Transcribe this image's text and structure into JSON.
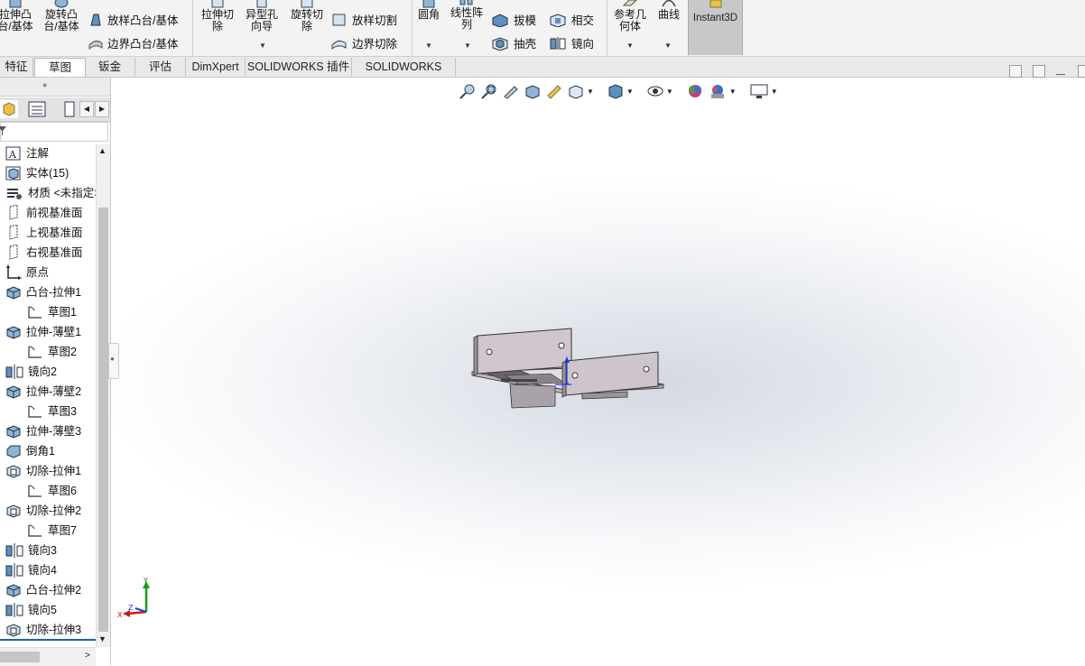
{
  "ribbon": {
    "extrude_boss": "拉伸凸\n台/基体",
    "revolve_boss": "旋转凸\n台/基体",
    "loft_boss": "放样凸台/基体",
    "boundary_boss": "边界凸台/基体",
    "extrude_cut": "拉伸切\n除",
    "hole_wizard": "异型孔\n向导",
    "revolve_cut": "旋转切\n除",
    "loft_cut": "放样切割",
    "boundary_cut": "边界切除",
    "fillet": "圆角",
    "linear_pattern": "线性阵\n列",
    "draft": "拔模",
    "shell": "抽壳",
    "intersect": "相交",
    "mirror": "镜向",
    "ref_geometry": "参考几\n何体",
    "curves": "曲线",
    "instant3d": "Instant3D"
  },
  "tabs": [
    "特征",
    "草图",
    "钣金",
    "评估",
    "DimXpert",
    "SOLIDWORKS 插件",
    "SOLIDWORKS MBD"
  ],
  "tree": [
    {
      "label": "注解",
      "icon": "annotation-icon"
    },
    {
      "label": "实体(15)",
      "icon": "solid-bodies-icon"
    },
    {
      "label": "材质 <未指定>",
      "icon": "material-icon"
    },
    {
      "label": "前视基准面",
      "icon": "plane-icon"
    },
    {
      "label": "上视基准面",
      "icon": "plane-icon"
    },
    {
      "label": "右视基准面",
      "icon": "plane-icon"
    },
    {
      "label": "原点",
      "icon": "origin-icon"
    },
    {
      "label": "凸台-拉伸1",
      "icon": "extrude-icon"
    },
    {
      "label": "草图1",
      "icon": "sketch-icon"
    },
    {
      "label": "拉伸-薄壁1",
      "icon": "extrude-icon"
    },
    {
      "label": "草图2",
      "icon": "sketch-icon"
    },
    {
      "label": "镜向2",
      "icon": "mirror-icon"
    },
    {
      "label": "拉伸-薄壁2",
      "icon": "extrude-icon"
    },
    {
      "label": "草图3",
      "icon": "sketch-icon"
    },
    {
      "label": "拉伸-薄壁3",
      "icon": "extrude-icon"
    },
    {
      "label": "倒角1",
      "icon": "chamfer-icon"
    },
    {
      "label": "切除-拉伸1",
      "icon": "cut-icon"
    },
    {
      "label": "草图6",
      "icon": "sketch-icon"
    },
    {
      "label": "切除-拉伸2",
      "icon": "cut-icon"
    },
    {
      "label": "草图7",
      "icon": "sketch-icon"
    },
    {
      "label": "镜向3",
      "icon": "mirror-icon"
    },
    {
      "label": "镜向4",
      "icon": "mirror-icon"
    },
    {
      "label": "凸台-拉伸2",
      "icon": "extrude-icon"
    },
    {
      "label": "镜向5",
      "icon": "mirror-icon"
    },
    {
      "label": "切除-拉伸3",
      "icon": "cut-icon"
    }
  ],
  "triad": {
    "x": "X",
    "y": "Y",
    "z": "Z"
  },
  "colors": {
    "accent": "#1a5fb4",
    "part": "#cdc4cc"
  }
}
